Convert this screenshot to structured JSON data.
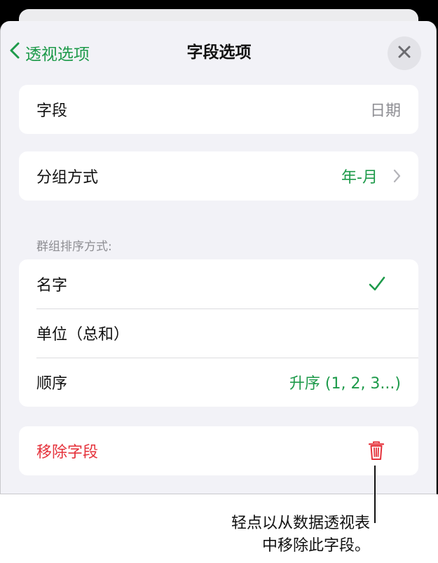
{
  "nav": {
    "back_label": "透视选项",
    "title": "字段选项",
    "close_icon": "close-icon"
  },
  "field_row": {
    "label": "字段",
    "value": "日期"
  },
  "group_row": {
    "label": "分组方式",
    "value": "年-月"
  },
  "sort_section": {
    "header": "群组排序方式:",
    "rows": [
      {
        "label": "名字",
        "value": "",
        "checked": true
      },
      {
        "label": "单位（总和）",
        "value": ""
      },
      {
        "label": "顺序",
        "value": "升序 (1, 2, 3...)"
      }
    ]
  },
  "remove_row": {
    "label": "移除字段",
    "icon": "trash-icon"
  },
  "callout": {
    "line1": "轻点以从数据透视表",
    "line2": "中移除此字段。"
  },
  "colors": {
    "accent": "#1d9a4a",
    "destructive": "#e5323b",
    "secondary_text": "#8e8e93",
    "sheet_background": "#f2f2f7"
  }
}
